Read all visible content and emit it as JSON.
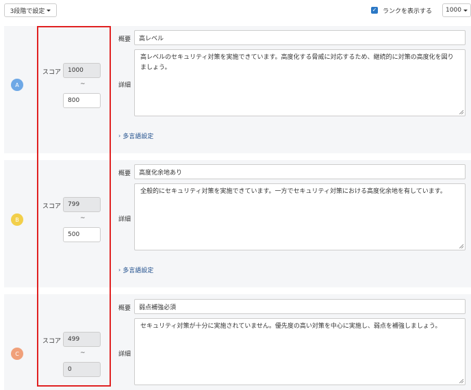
{
  "toolbar": {
    "levels_button": "3段階で設定",
    "show_rank_label": "ランクを表示する",
    "show_rank_checked": true,
    "max_score_select": "1000"
  },
  "common": {
    "score_label": "スコア",
    "summary_label": "概要",
    "detail_label": "詳細",
    "range_separator": "~",
    "multilang_label": "多言語設定"
  },
  "ranks": [
    {
      "letter": "A",
      "color": "#6ea8e6",
      "score_max": "1000",
      "score_min": "800",
      "summary": "高レベル",
      "detail": "高レベルのセキュリティ対策を実施できています。高度化する脅威に対応するため、継続的に対策の高度化を図りましょう。"
    },
    {
      "letter": "B",
      "color": "#f2cf4a",
      "score_max": "799",
      "score_min": "500",
      "summary": "高度化余地あり",
      "detail": "全般的にセキュリティ対策を実施できています。一方でセキュリティ対策における高度化余地を有しています。"
    },
    {
      "letter": "C",
      "color": "#f0a07a",
      "score_max": "499",
      "score_min": "0",
      "summary": "弱点補強必須",
      "detail": "セキュリティ対策が十分に実施されていません。優先度の高い対策を中心に実施し、弱点を補強しましょう。"
    }
  ]
}
